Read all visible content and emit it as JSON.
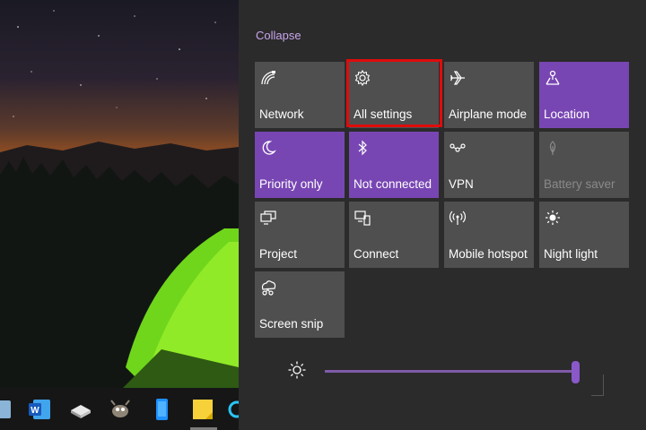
{
  "action_center": {
    "collapse_label": "Collapse",
    "tiles": [
      {
        "label": "Network",
        "icon": "network-icon",
        "state": "off"
      },
      {
        "label": "All settings",
        "icon": "settings-gear-icon",
        "state": "off",
        "highlighted": true
      },
      {
        "label": "Airplane mode",
        "icon": "airplane-icon",
        "state": "off"
      },
      {
        "label": "Location",
        "icon": "location-icon",
        "state": "on"
      },
      {
        "label": "Priority only",
        "icon": "moon-icon",
        "state": "on"
      },
      {
        "label": "Not connected",
        "icon": "bluetooth-icon",
        "state": "on"
      },
      {
        "label": "VPN",
        "icon": "vpn-icon",
        "state": "off"
      },
      {
        "label": "Battery saver",
        "icon": "battery-saver-icon",
        "state": "disabled"
      },
      {
        "label": "Project",
        "icon": "project-icon",
        "state": "off"
      },
      {
        "label": "Connect",
        "icon": "connect-icon",
        "state": "off"
      },
      {
        "label": "Mobile hotspot",
        "icon": "hotspot-icon",
        "state": "off"
      },
      {
        "label": "Night light",
        "icon": "night-light-icon",
        "state": "off"
      },
      {
        "label": "Screen snip",
        "icon": "screen-snip-icon",
        "state": "off"
      }
    ],
    "brightness": {
      "icon": "brightness-sun-icon",
      "level_fraction": 1.0
    }
  },
  "taskbar": {
    "icons": [
      "recycle-bin-icon",
      "word-icon",
      "drive-icon",
      "gimp-icon",
      "phone-icon",
      "sticky-notes-icon",
      "app-icon"
    ]
  },
  "colors": {
    "accent": "#7846b3",
    "tile_off": "#4f4f4f",
    "panel_bg": "#2b2b2b",
    "collapse_text": "#c9a5ec",
    "highlight_border": "#e00b0b"
  }
}
